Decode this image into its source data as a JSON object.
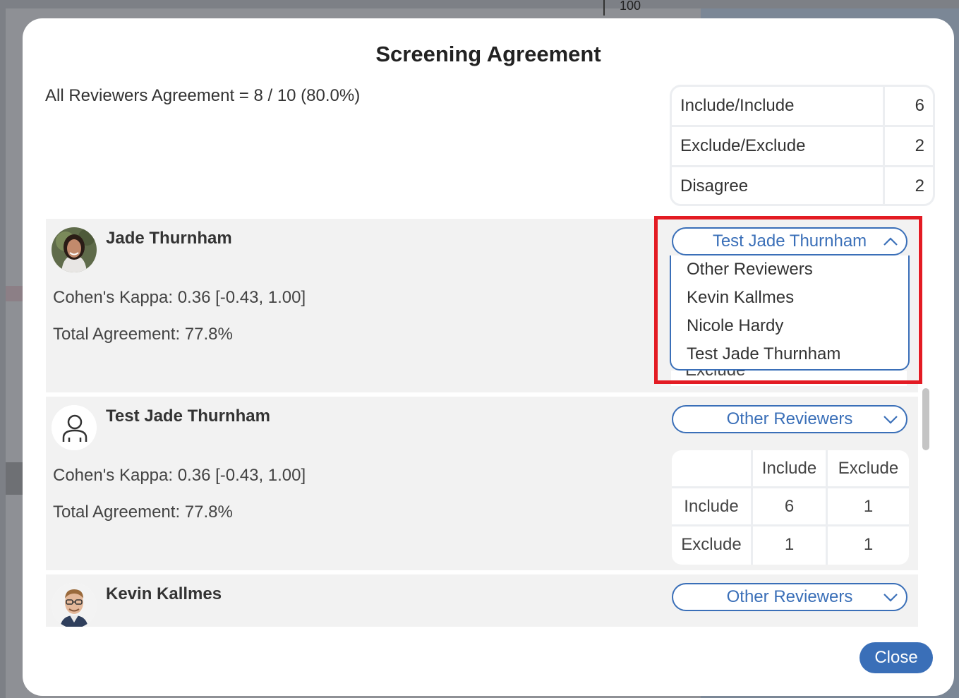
{
  "backdrop": {
    "axis_value": "100"
  },
  "modal": {
    "title": "Screening Agreement",
    "summary": "All Reviewers Agreement = 8 / 10 (80.0%)",
    "summary_table": [
      {
        "label": "Include/Include",
        "value": "6"
      },
      {
        "label": "Exclude/Exclude",
        "value": "2"
      },
      {
        "label": "Disagree",
        "value": "2"
      }
    ],
    "close_label": "Close"
  },
  "reviewers": [
    {
      "name": "Jade Thurnham",
      "kappa": "Cohen's Kappa: 0.36 [-0.43, 1.00]",
      "agreement": "Total Agreement: 77.8%",
      "compare_select": "Test Jade Thurnham",
      "dropdown_open": true,
      "dropdown_options": [
        "Other Reviewers",
        "Kevin Kallmes",
        "Nicole Hardy",
        "Test Jade Thurnham"
      ],
      "hidden_row_label": "Exclude"
    },
    {
      "name": "Test Jade Thurnham",
      "kappa": "Cohen's Kappa: 0.36 [-0.43, 1.00]",
      "agreement": "Total Agreement: 77.8%",
      "compare_select": "Other Reviewers",
      "matrix": {
        "col_headers": [
          "",
          "Include",
          "Exclude"
        ],
        "rows": [
          {
            "label": "Include",
            "values": [
              "6",
              "1"
            ]
          },
          {
            "label": "Exclude",
            "values": [
              "1",
              "1"
            ]
          }
        ]
      }
    },
    {
      "name": "Kevin Kallmes",
      "compare_select": "Other Reviewers"
    }
  ],
  "colors": {
    "accent": "#3a6fb8",
    "highlight": "#e31b23",
    "card_bg": "#f2f2f2"
  },
  "icons": {
    "select_closed": "chevron-down-icon",
    "select_open": "chevron-up-icon",
    "placeholder_avatar": "user-icon"
  }
}
